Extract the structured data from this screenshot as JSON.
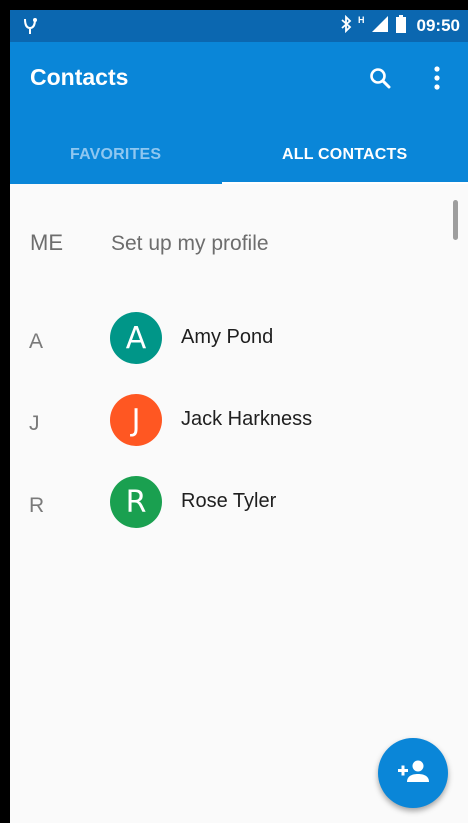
{
  "status_bar": {
    "time": "09:50",
    "network_type": "H",
    "icons": [
      "notification-icon",
      "bluetooth-icon",
      "signal-icon",
      "battery-icon"
    ]
  },
  "app_bar": {
    "title": "Contacts",
    "search_icon": "search-icon",
    "menu_icon": "more-vert-icon",
    "color": "#0a86d8"
  },
  "tabs": [
    {
      "label": "FAVORITES",
      "selected": false
    },
    {
      "label": "ALL CONTACTS",
      "selected": true
    }
  ],
  "profile": {
    "section": "ME",
    "label": "Set up my profile"
  },
  "contacts": [
    {
      "section": "A",
      "initial": "A",
      "name": "Amy Pond",
      "color": "#009688"
    },
    {
      "section": "J",
      "initial": "J",
      "name": "Jack Harkness",
      "color": "#ff5722"
    },
    {
      "section": "R",
      "initial": "R",
      "name": "Rose Tyler",
      "color": "#1aa050"
    }
  ],
  "fab": {
    "icon": "add-person-icon"
  }
}
